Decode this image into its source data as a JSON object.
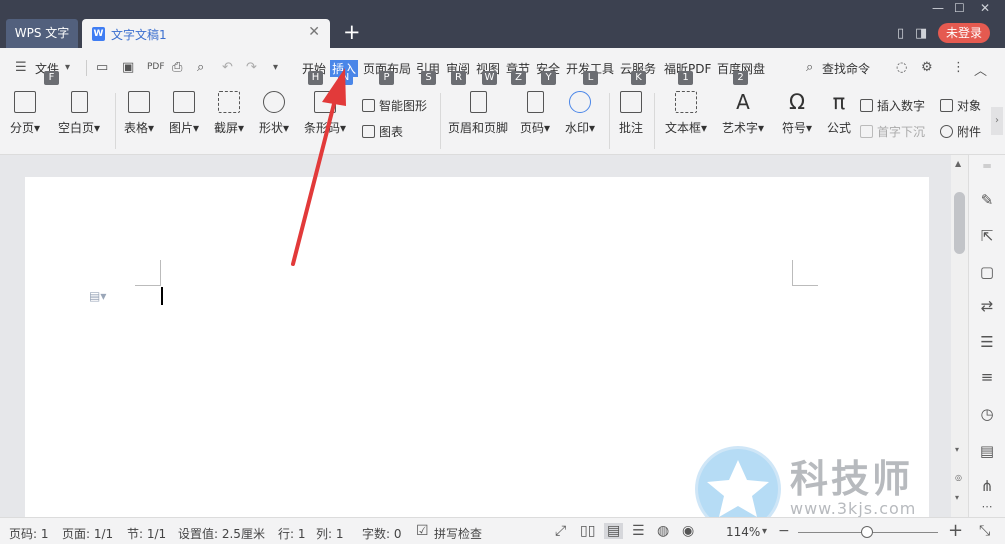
{
  "titlebar": {
    "app_tab": "WPS 文字",
    "doc_tab": "文字文稿1",
    "doc_tab_icon": "W",
    "close_glyph": "✕",
    "new_tab_glyph": "+",
    "login_label": "未登录",
    "login_color": "#e55a50"
  },
  "menu": {
    "file_label": "文件",
    "file_key": "F",
    "items": [
      {
        "label": "开始",
        "key": "H"
      },
      {
        "label": "插入",
        "key": "N",
        "active": true
      },
      {
        "label": "页面布局",
        "key": "P"
      },
      {
        "label": "引用",
        "key": "S"
      },
      {
        "label": "审阅",
        "key": "R"
      },
      {
        "label": "视图",
        "key": "W"
      },
      {
        "label": "章节",
        "key": "Z"
      },
      {
        "label": "安全",
        "key": "Y"
      },
      {
        "label": "开发工具",
        "key": "L"
      },
      {
        "label": "云服务",
        "key": "K"
      },
      {
        "label": "福昕PDF",
        "key": "1"
      },
      {
        "label": "百度网盘",
        "key": "2"
      }
    ],
    "search_label": "查找命令",
    "accent_color": "#4a86e8"
  },
  "ribbon": {
    "buttons": [
      {
        "label": "分页",
        "dropdown": true
      },
      {
        "label": "空白页",
        "dropdown": true
      },
      {
        "label": "表格",
        "dropdown": true
      },
      {
        "label": "图片",
        "dropdown": true
      },
      {
        "label": "截屏",
        "dropdown": true
      },
      {
        "label": "形状",
        "dropdown": true
      },
      {
        "label": "条形码",
        "dropdown": true
      },
      {
        "label": "页眉和页脚",
        "dropdown": false
      },
      {
        "label": "页码",
        "dropdown": true
      },
      {
        "label": "水印",
        "dropdown": true
      },
      {
        "label": "批注",
        "dropdown": false
      },
      {
        "label": "文本框",
        "dropdown": true
      },
      {
        "label": "艺术字",
        "dropdown": true
      },
      {
        "label": "符号",
        "dropdown": true
      },
      {
        "label": "公式",
        "dropdown": false
      }
    ],
    "small": {
      "smart_shape": "智能图形",
      "chart": "图表",
      "insert_number": "插入数字",
      "drop_cap": "首字下沉",
      "object": "对象",
      "attachment": "附件"
    }
  },
  "statusbar": {
    "page_no": "页码: 1",
    "pages": "页面: 1/1",
    "section": "节: 1/1",
    "setting": "设置值: 2.5厘米",
    "row": "行: 1",
    "col": "列: 1",
    "word_count": "字数: 0",
    "spell_check": "拼写检查",
    "zoom": "114%",
    "zoom_level": 0.49
  },
  "watermark": {
    "text": "科技师",
    "url": "www.3kjs.com"
  }
}
